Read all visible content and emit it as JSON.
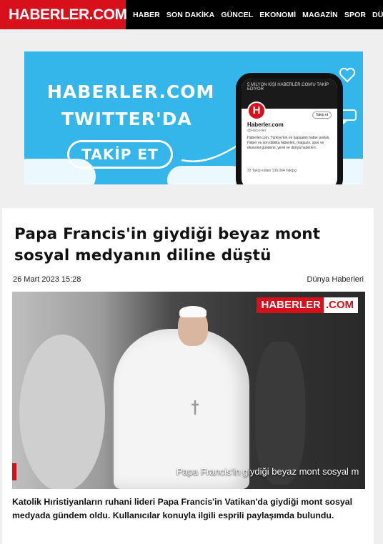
{
  "site": {
    "logo": "HABERLER.COM"
  },
  "nav": {
    "items": [
      "HABER",
      "SON DAKİKA",
      "GÜNCEL",
      "EKONOMİ",
      "MAGAZİN",
      "SPOR",
      "DÜNYA"
    ]
  },
  "banner": {
    "line1": "HABERLER.COM",
    "line2": "TWITTER'DA",
    "button": "TAKİP ET",
    "phone": {
      "cover_text": "5 MİLYON KİŞİ HABERLER.COM'U TAKİP EDİYOR",
      "avatar": "H",
      "name": "Haberler.com",
      "handle": "@Haberler",
      "follow": "Takip et",
      "bio": "Haberler.com, Türkiye'nin en kapsamlı haber portalı. Haber ve son dakika haberleri, magazin, spor ve ekonomi gündemi, yerel ve dünya haberleri.",
      "stats": "33 Takip edilen   136.064 Takipçi"
    }
  },
  "article": {
    "headline": "Papa Francis'in giydiği beyaz mont sosyal medyanın diline düştü",
    "date": "26 Mart 2023 15:28",
    "category": "Dünya Haberleri",
    "image": {
      "logo_left": "HABERLER",
      "logo_right": ".COM",
      "caption": "Papa Francis'in giydiği beyaz mont sosyal m"
    },
    "summary": "Katolik Hıristiyanların ruhani lideri Papa Francis'in Vatikan'da giydiği mont sosyal medyada gündem oldu. Kullanıcılar konuyla ilgili esprili paylaşımda bulundu."
  },
  "colors": {
    "brand_red": "#d8101b",
    "banner_blue": "#35b6ea",
    "nav_bg": "#000000"
  }
}
